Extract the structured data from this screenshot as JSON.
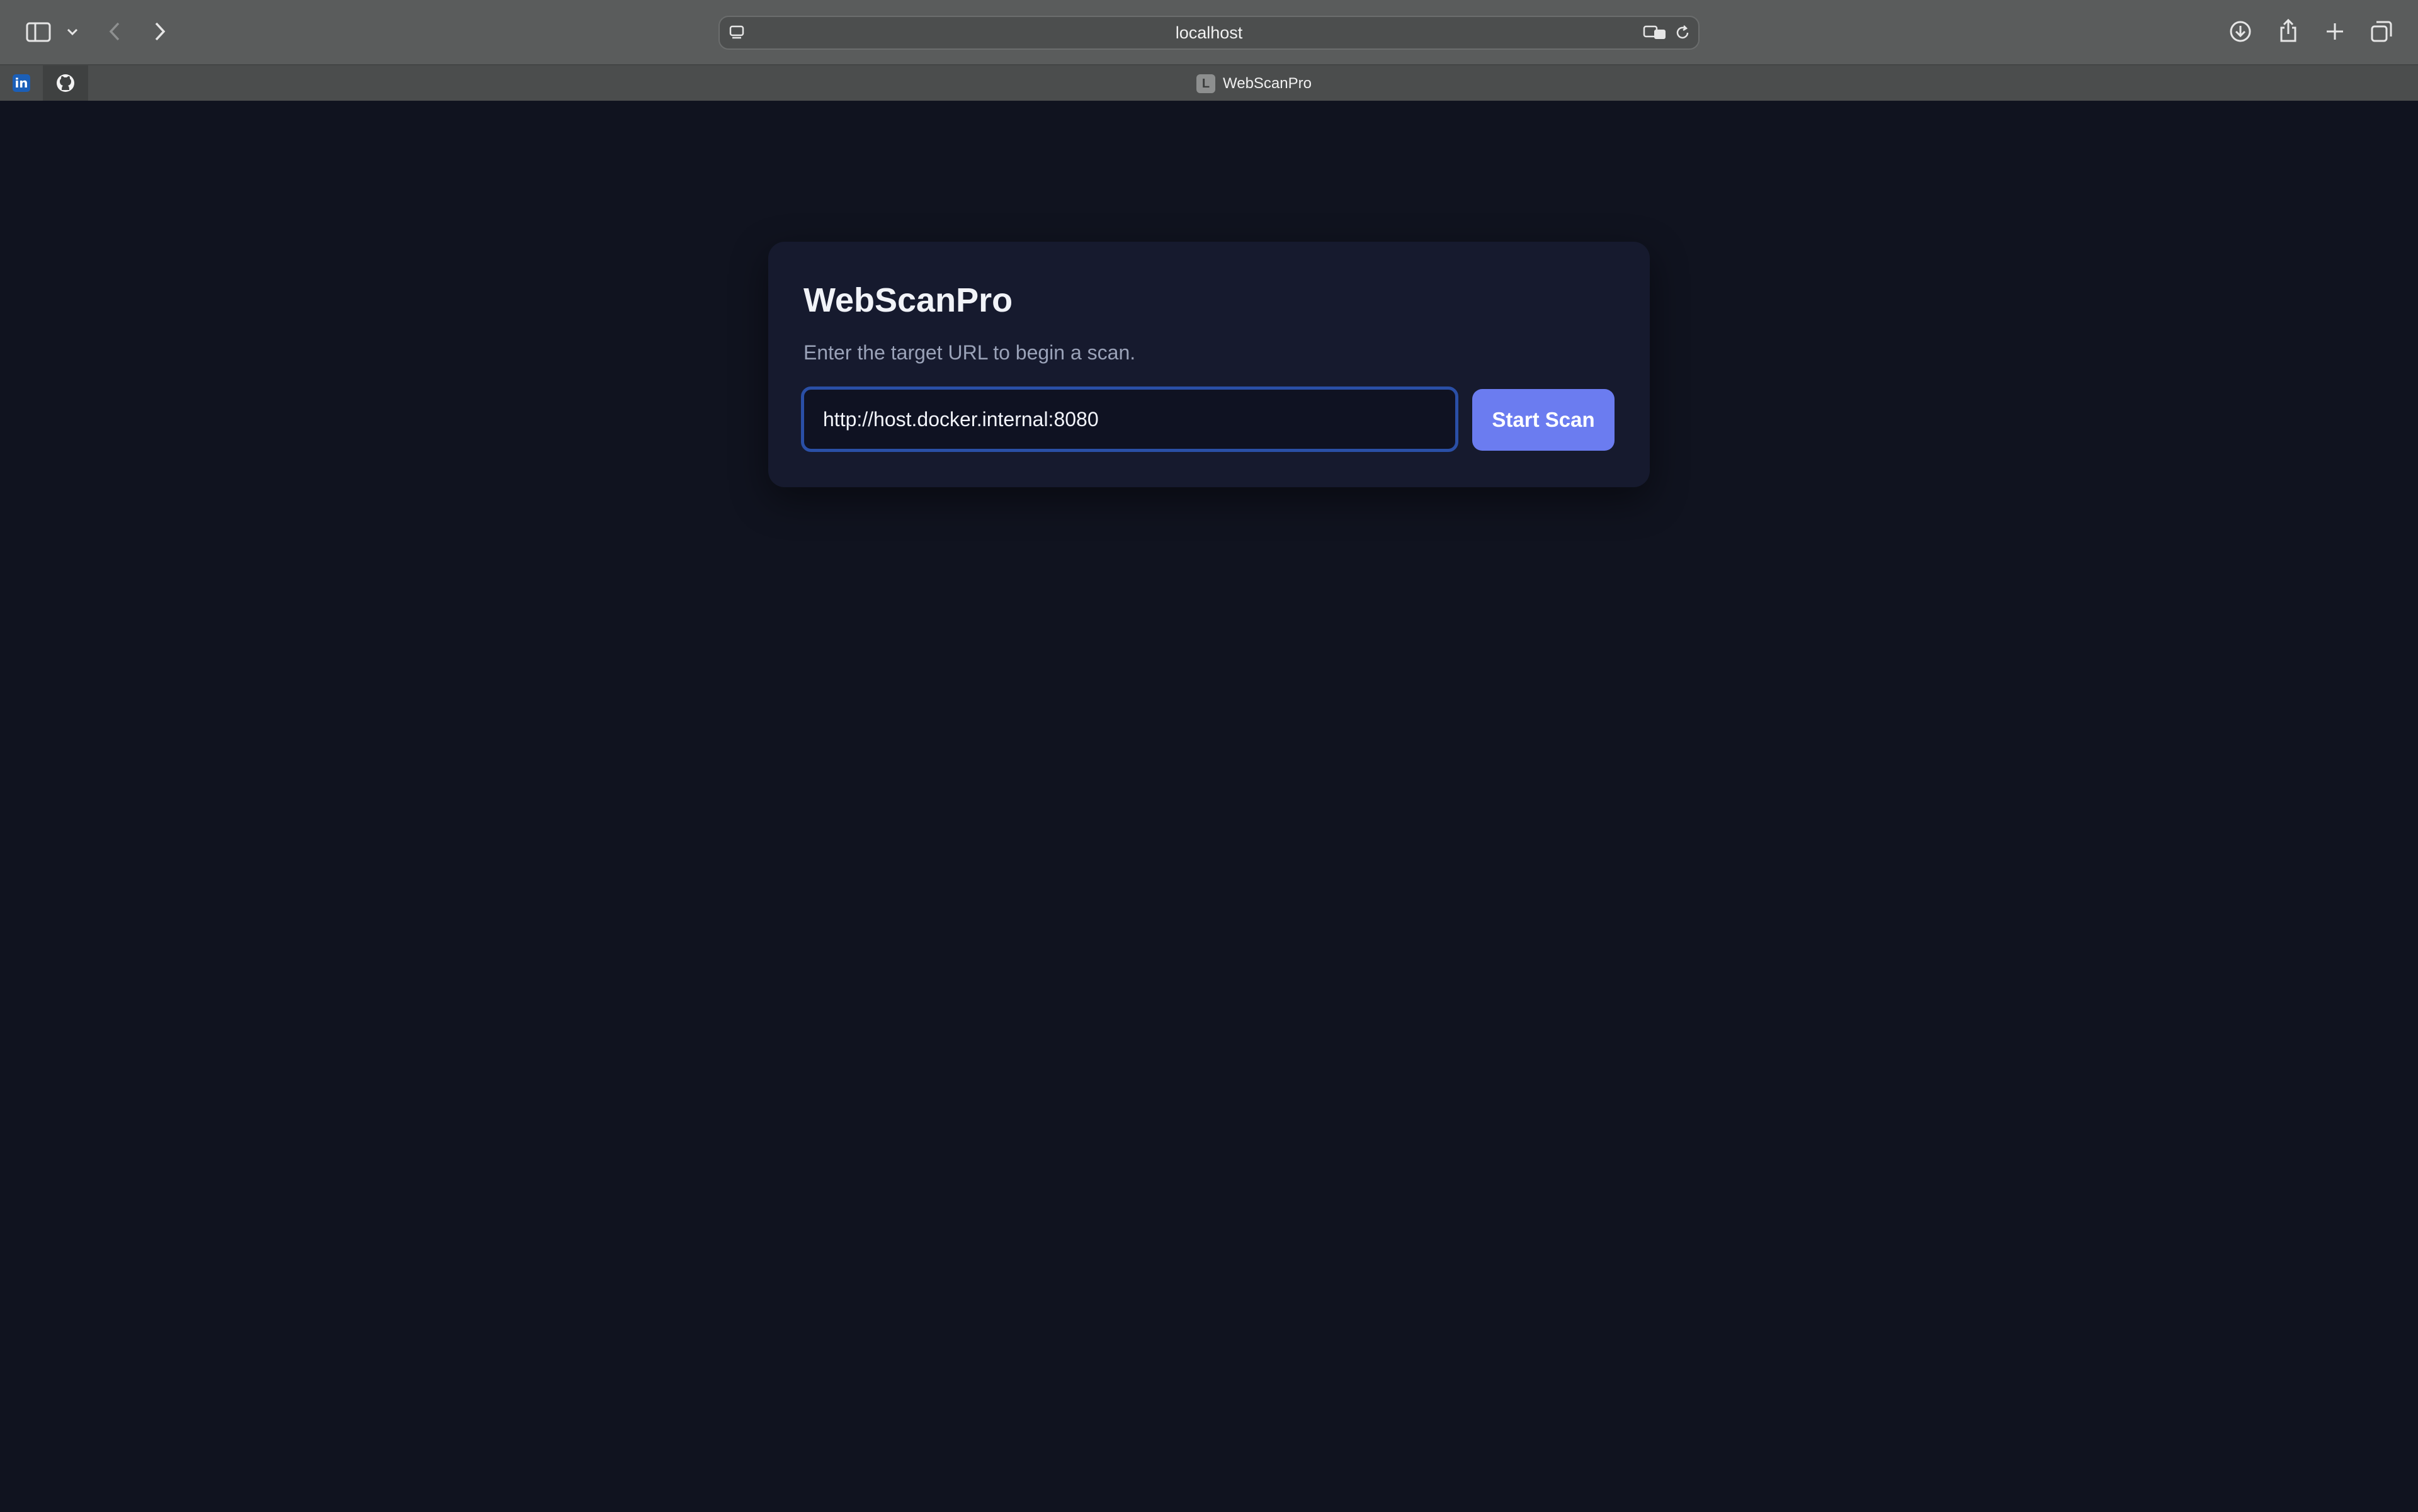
{
  "browser": {
    "address": "localhost",
    "active_tab_title": "WebScanPro",
    "active_tab_favicon_letter": "L",
    "pinned_tabs": [
      {
        "name": "linkedin",
        "glyph": "in"
      },
      {
        "name": "github",
        "glyph": ""
      }
    ]
  },
  "card": {
    "title": "WebScanPro",
    "subtitle": "Enter the target URL to begin a scan.",
    "url_value": "http://host.docker.internal:8080",
    "start_button": "Start Scan"
  },
  "colors": {
    "page_background": "#10131f",
    "card_background": "#161a2e",
    "accent": "#6b7cf0",
    "input_focus_border": "#2a4fa6",
    "toolbar": "#5a5c5c"
  }
}
